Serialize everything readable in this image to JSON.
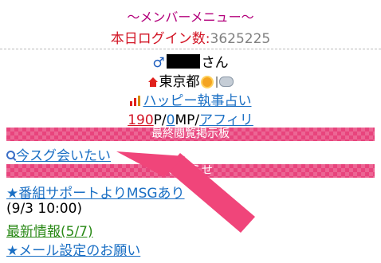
{
  "menu": {
    "title": "～メンバーメニュー～",
    "login_label": "本日ログイン数:",
    "login_count": "3625225"
  },
  "user": {
    "gender_symbol": "♂",
    "honorific": "さん"
  },
  "location": {
    "prefecture": "東京都",
    "weather_icons": [
      "sun-icon",
      "cloud-icon"
    ]
  },
  "fortune_link": "ハッピー執事占い",
  "points": {
    "p_value": "190",
    "p_unit": "P/",
    "mp_value": "0",
    "mp_unit": "MP/",
    "affiliate": "アフィリ"
  },
  "sections": {
    "last_viewed_header": "最終閲覧掲示板",
    "last_viewed_link": "今スグ会いたい",
    "notice_header": "お知らせ"
  },
  "notices": [
    {
      "text": "★番組サポートよりMSGあり"
    },
    {
      "text": "(9/3 10:00)"
    },
    {
      "text": "最新情報(5/7)"
    },
    {
      "text": "★メール設定のお願い"
    }
  ],
  "colors": {
    "band_pink": "#e8447d",
    "arrow_pink": "#f0457a",
    "link_blue": "#1a6fc4",
    "title_magenta": "#b3007b"
  }
}
